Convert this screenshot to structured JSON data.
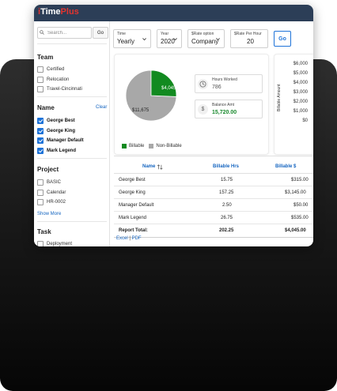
{
  "app": {
    "logo_dot": "i",
    "logo_main": "Time",
    "logo_plus": "Plus"
  },
  "sidebar": {
    "search_placeholder": "Search...",
    "go_label": "Go",
    "team": {
      "title": "Team",
      "items": [
        {
          "label": "Certified",
          "checked": false
        },
        {
          "label": "Relocation",
          "checked": false
        },
        {
          "label": "Travel-Cincinnati",
          "checked": false
        }
      ]
    },
    "name": {
      "title": "Name",
      "clear_label": "Clear",
      "items": [
        {
          "label": "George Best",
          "checked": true
        },
        {
          "label": "George King",
          "checked": true
        },
        {
          "label": "Manager Default",
          "checked": true
        },
        {
          "label": "Mark Legend",
          "checked": true
        }
      ]
    },
    "project": {
      "title": "Project",
      "items": [
        {
          "label": "BASIC",
          "checked": false
        },
        {
          "label": "Calendar",
          "checked": false
        },
        {
          "label": "HR-0002",
          "checked": false
        }
      ],
      "show_more": "Show More"
    },
    "task": {
      "title": "Task",
      "items": [
        {
          "label": "Deployment",
          "checked": false
        }
      ]
    }
  },
  "filters": {
    "time": {
      "label": "Time",
      "value": "Yearly"
    },
    "year": {
      "label": "Year",
      "value": "2020"
    },
    "rate_option": {
      "label": "$Rate option",
      "value": "Company"
    },
    "rate_per_hour": {
      "label": "$Rate Per Hour",
      "value": "20"
    },
    "go_label": "Go"
  },
  "summary": {
    "pie": {
      "billable_label": "$4,045",
      "non_billable_label": "$11,675",
      "billable_fraction": 0.257
    },
    "legend": {
      "billable": "Billable",
      "non_billable": "Non-Billable"
    },
    "hours_worked": {
      "label": "Hours Worked",
      "value": "786"
    },
    "balance_amt": {
      "label": "Balance Amt",
      "value": "15,720.00",
      "icon": "$"
    }
  },
  "bar_chart": {
    "y_ticks": [
      "$6,000",
      "$5,000",
      "$4,000",
      "$3,000",
      "$2,000",
      "$1,000",
      "$0"
    ],
    "ylabel": "Billable Amount"
  },
  "table": {
    "headers": {
      "name": "Name",
      "billable_hrs": "Billable Hrs",
      "billable_amt": "Billable $"
    },
    "rows": [
      {
        "name": "George Best",
        "hrs": "15.75",
        "amt": "$315.00"
      },
      {
        "name": "George King",
        "hrs": "157.25",
        "amt": "$3,145.00"
      },
      {
        "name": "Manager Default",
        "hrs": "2.50",
        "amt": "$50.00"
      },
      {
        "name": "Mark Legend",
        "hrs": "26.75",
        "amt": "$535.00"
      }
    ],
    "total": {
      "name": "Report Total:",
      "hrs": "202.25",
      "amt": "$4,045.00"
    }
  },
  "export": {
    "excel": "Excel",
    "separator": "|",
    "pdf": "PDF"
  },
  "colors": {
    "header": "#2c3e57",
    "accent": "#1e73d8",
    "billable": "#128a20",
    "non_billable": "#a8a8a8",
    "logo_red": "#e3342f"
  }
}
